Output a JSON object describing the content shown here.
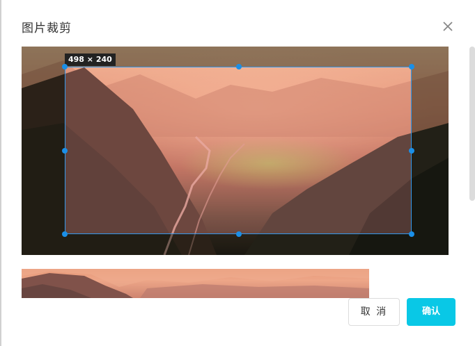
{
  "dialog": {
    "title": "图片裁剪",
    "close_icon": "close-icon"
  },
  "cropper": {
    "size_label": "498 × 240",
    "accent_color": "#3399ee"
  },
  "buttons": {
    "cancel_label": "取 消",
    "confirm_label": "确认",
    "confirm_color": "#09c8e6"
  }
}
